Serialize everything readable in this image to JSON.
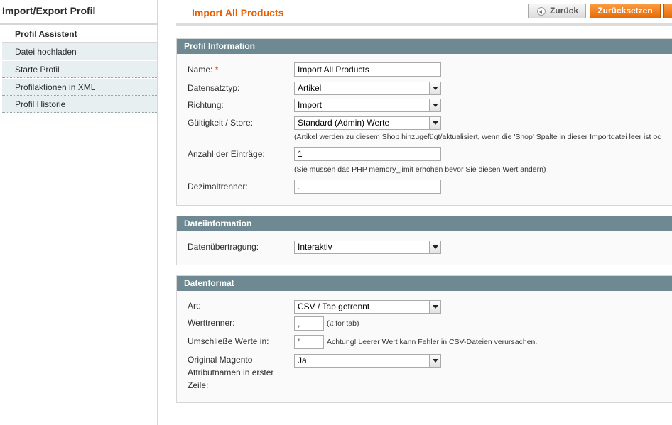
{
  "sidebar": {
    "title": "Import/Export Profil",
    "items": [
      {
        "label": "Profil Assistent"
      },
      {
        "label": "Datei hochladen"
      },
      {
        "label": "Starte Profil"
      },
      {
        "label": "Profilaktionen in XML"
      },
      {
        "label": "Profil Historie"
      }
    ]
  },
  "header": {
    "title": "Import All Products",
    "back_label": "Zurück",
    "reset_label": "Zurücksetzen"
  },
  "profile_info": {
    "heading": "Profil Information",
    "name_label": "Name:",
    "name_required": "*",
    "name_value": "Import All Products",
    "entity_label": "Datensatztyp:",
    "entity_value": "Artikel",
    "direction_label": "Richtung:",
    "direction_value": "Import",
    "store_label": "Gültigkeit / Store:",
    "store_value": "Standard (Admin) Werte",
    "store_note": "(Artikel werden zu diesem Shop hinzugefügt/aktualisiert, wenn die 'Shop' Spalte in dieser Importdatei leer ist oc",
    "count_label": "Anzahl der Einträge:",
    "count_value": "1",
    "count_note": "(Sie müssen das PHP memory_limit erhöhen bevor Sie diesen Wert ändern)",
    "decimal_label": "Dezimaltrenner:",
    "decimal_value": "."
  },
  "file_info": {
    "heading": "Dateiinformation",
    "transfer_label": "Datenübertragung:",
    "transfer_value": "Interaktiv"
  },
  "data_format": {
    "heading": "Datenformat",
    "type_label": "Art:",
    "type_value": "CSV / Tab getrennt",
    "delimiter_label": "Werttrenner:",
    "delimiter_value": ",",
    "delimiter_note": "(\\t for tab)",
    "enclose_label": "Umschließe Werte in:",
    "enclose_value": "\"",
    "enclose_note": "Achtung! Leerer Wert kann Fehler in CSV-Dateien verursachen.",
    "header_label_1": "Original Magento",
    "header_label_2": "Attributnamen in erster",
    "header_label_3": "Zeile:",
    "header_value": "Ja"
  }
}
